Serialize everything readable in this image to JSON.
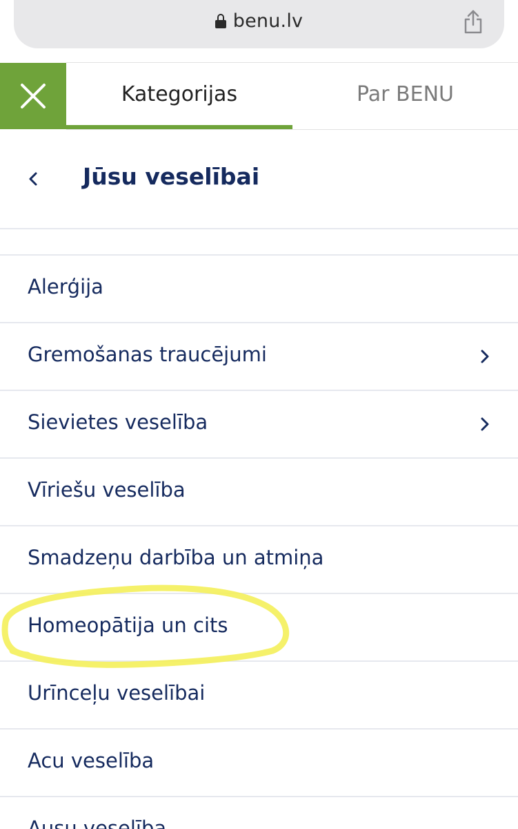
{
  "browser": {
    "url": "benu.lv",
    "lock_icon": "lock-icon",
    "share_icon": "share-icon"
  },
  "menu": {
    "close_icon": "close-icon",
    "accent_color": "#6fa33a",
    "tabs": [
      {
        "label": "Kategorijas",
        "active": true
      },
      {
        "label": "Par BENU",
        "active": false
      }
    ]
  },
  "section": {
    "back_icon": "chevron-left-icon",
    "title": "Jūsu veselībai"
  },
  "categories": [
    {
      "label": "Alerģija",
      "has_submenu": false
    },
    {
      "label": "Gremošanas traucējumi",
      "has_submenu": true
    },
    {
      "label": "Sievietes veselība",
      "has_submenu": true
    },
    {
      "label": "Vīriešu veselība",
      "has_submenu": false
    },
    {
      "label": "Smadzeņu darbība un atmiņa",
      "has_submenu": false
    },
    {
      "label": "Homeopātija un cits",
      "has_submenu": false,
      "highlighted": true
    },
    {
      "label": "Urīnceļu veselībai",
      "has_submenu": false
    },
    {
      "label": "Acu veselība",
      "has_submenu": false
    },
    {
      "label": "Ausu veselība",
      "has_submenu": false
    }
  ],
  "colors": {
    "text_primary": "#152a5e",
    "highlight": "#f4f05a"
  }
}
